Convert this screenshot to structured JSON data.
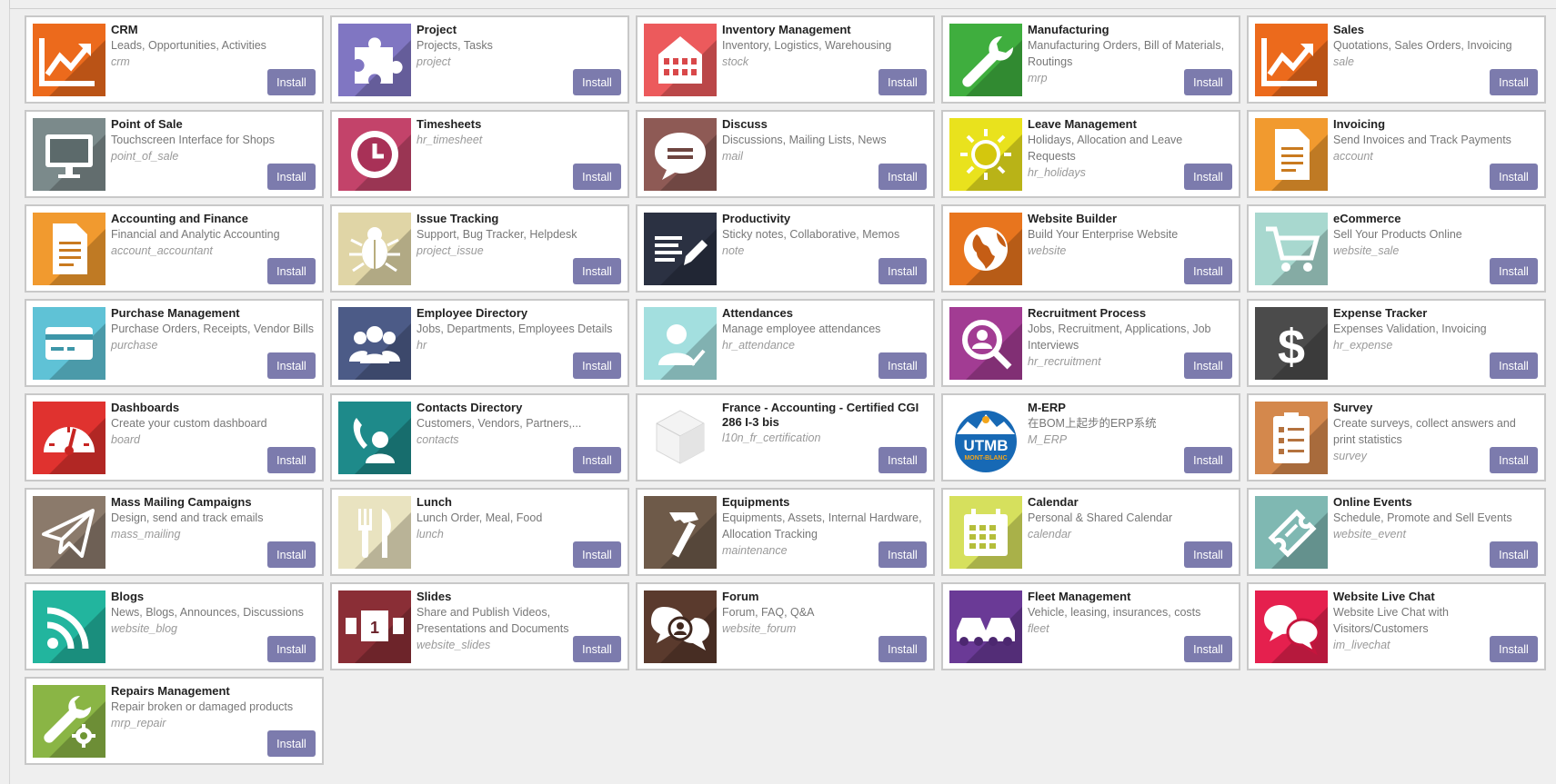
{
  "install_label": "Install",
  "apps": [
    {
      "name": "CRM",
      "summary": "Leads, Opportunities, Activities",
      "tech": "crm",
      "icon": "chart-line-icon",
      "color": "#ec6a1c"
    },
    {
      "name": "Project",
      "summary": "Projects, Tasks",
      "tech": "project",
      "icon": "puzzle-icon",
      "color": "#8076c2"
    },
    {
      "name": "Inventory Management",
      "summary": "Inventory, Logistics, Warehousing",
      "tech": "stock",
      "icon": "warehouse-icon",
      "color": "#ec5a5c"
    },
    {
      "name": "Manufacturing",
      "summary": "Manufacturing Orders, Bill of Materials, Routings",
      "tech": "mrp",
      "icon": "wrench-icon",
      "color": "#3fae3e"
    },
    {
      "name": "Sales",
      "summary": "Quotations, Sales Orders, Invoicing",
      "tech": "sale",
      "icon": "chart-line-icon",
      "color": "#ec6a1c"
    },
    {
      "name": "Point of Sale",
      "summary": "Touchscreen Interface for Shops",
      "tech": "point_of_sale",
      "icon": "monitor-icon",
      "color": "#7b8a8b"
    },
    {
      "name": "Timesheets",
      "summary": "",
      "tech": "hr_timesheet",
      "icon": "clock-icon",
      "color": "#c3436a"
    },
    {
      "name": "Discuss",
      "summary": "Discussions, Mailing Lists, News",
      "tech": "mail",
      "icon": "chat-bubble-icon",
      "color": "#8e5a55"
    },
    {
      "name": "Leave Management",
      "summary": "Holidays, Allocation and Leave Requests",
      "tech": "hr_holidays",
      "icon": "sun-icon",
      "color": "#e9e21d"
    },
    {
      "name": "Invoicing",
      "summary": "Send Invoices and Track Payments",
      "tech": "account",
      "icon": "document-icon",
      "color": "#f19a2f"
    },
    {
      "name": "Accounting and Finance",
      "summary": "Financial and Analytic Accounting",
      "tech": "account_accountant",
      "icon": "document-icon",
      "color": "#f19a2f"
    },
    {
      "name": "Issue Tracking",
      "summary": "Support, Bug Tracker, Helpdesk",
      "tech": "project_issue",
      "icon": "bug-icon",
      "color": "#e0d5a6"
    },
    {
      "name": "Productivity",
      "summary": "Sticky notes, Collaborative, Memos",
      "tech": "note",
      "icon": "pencil-icon",
      "color": "#2b3142"
    },
    {
      "name": "Website Builder",
      "summary": "Build Your Enterprise Website",
      "tech": "website",
      "icon": "globe-icon",
      "color": "#e8751e"
    },
    {
      "name": "eCommerce",
      "summary": "Sell Your Products Online",
      "tech": "website_sale",
      "icon": "cart-icon",
      "color": "#a8d8cf"
    },
    {
      "name": "Purchase Management",
      "summary": "Purchase Orders, Receipts, Vendor Bills",
      "tech": "purchase",
      "icon": "credit-card-icon",
      "color": "#5fc2d6"
    },
    {
      "name": "Employee Directory",
      "summary": "Jobs, Departments, Employees Details",
      "tech": "hr",
      "icon": "users-icon",
      "color": "#4c5b87"
    },
    {
      "name": "Attendances",
      "summary": "Manage employee attendances",
      "tech": "hr_attendance",
      "icon": "user-check-icon",
      "color": "#a3dfdf"
    },
    {
      "name": "Recruitment Process",
      "summary": "Jobs, Recruitment, Applications, Job Interviews",
      "tech": "hr_recruitment",
      "icon": "search-user-icon",
      "color": "#a23c93"
    },
    {
      "name": "Expense Tracker",
      "summary": "Expenses Validation, Invoicing",
      "tech": "hr_expense",
      "icon": "dollar-icon",
      "color": "#4b4b4b"
    },
    {
      "name": "Dashboards",
      "summary": "Create your custom dashboard",
      "tech": "board",
      "icon": "gauge-icon",
      "color": "#e0322f"
    },
    {
      "name": "Contacts Directory",
      "summary": "Customers, Vendors, Partners,...",
      "tech": "contacts",
      "icon": "phone-user-icon",
      "color": "#1e8a8a"
    },
    {
      "name": "France - Accounting - Certified CGI 286 I-3 bis",
      "summary": "",
      "tech": "l10n_fr_certification",
      "icon": "cube-icon",
      "color": "#ffffff"
    },
    {
      "name": "M-ERP",
      "summary": "在BOM上起步的ERP系统",
      "tech": "M_ERP",
      "icon": "utmb-logo-icon",
      "color": "#ffffff",
      "logo_text": "UTMB",
      "logo_sub": "MONT-BLANC"
    },
    {
      "name": "Survey",
      "summary": "Create surveys, collect answers and print statistics",
      "tech": "survey",
      "icon": "clipboard-icon",
      "color": "#d4884c"
    },
    {
      "name": "Mass Mailing Campaigns",
      "summary": "Design, send and track emails",
      "tech": "mass_mailing",
      "icon": "paper-plane-icon",
      "color": "#8b7a6b"
    },
    {
      "name": "Lunch",
      "summary": "Lunch Order, Meal, Food",
      "tech": "lunch",
      "icon": "fork-knife-icon",
      "color": "#e9e3c0"
    },
    {
      "name": "Equipments",
      "summary": "Equipments, Assets, Internal Hardware, Allocation Tracking",
      "tech": "maintenance",
      "icon": "hammer-icon",
      "color": "#6e5a49"
    },
    {
      "name": "Calendar",
      "summary": "Personal & Shared Calendar",
      "tech": "calendar",
      "icon": "calendar-icon",
      "color": "#d6e05d"
    },
    {
      "name": "Online Events",
      "summary": "Schedule, Promote and Sell Events",
      "tech": "website_event",
      "icon": "ticket-icon",
      "color": "#7fb8b2"
    },
    {
      "name": "Blogs",
      "summary": "News, Blogs, Announces, Discussions",
      "tech": "website_blog",
      "icon": "rss-icon",
      "color": "#22b59e"
    },
    {
      "name": "Slides",
      "summary": "Share and Publish Videos, Presentations and Documents",
      "tech": "website_slides",
      "icon": "slides-icon",
      "color": "#8a2e36",
      "slide_number": "1"
    },
    {
      "name": "Forum",
      "summary": "Forum, FAQ, Q&A",
      "tech": "website_forum",
      "icon": "forum-icon",
      "color": "#5a3a2d"
    },
    {
      "name": "Fleet Management",
      "summary": "Vehicle, leasing, insurances, costs",
      "tech": "fleet",
      "icon": "cars-icon",
      "color": "#6a3a96"
    },
    {
      "name": "Website Live Chat",
      "summary": "Website Live Chat with Visitors/Customers",
      "tech": "im_livechat",
      "icon": "chat-bubbles-icon",
      "color": "#e5204e"
    },
    {
      "name": "Repairs Management",
      "summary": "Repair broken or damaged products",
      "tech": "mrp_repair",
      "icon": "wrench-gear-icon",
      "color": "#8ab545"
    }
  ]
}
